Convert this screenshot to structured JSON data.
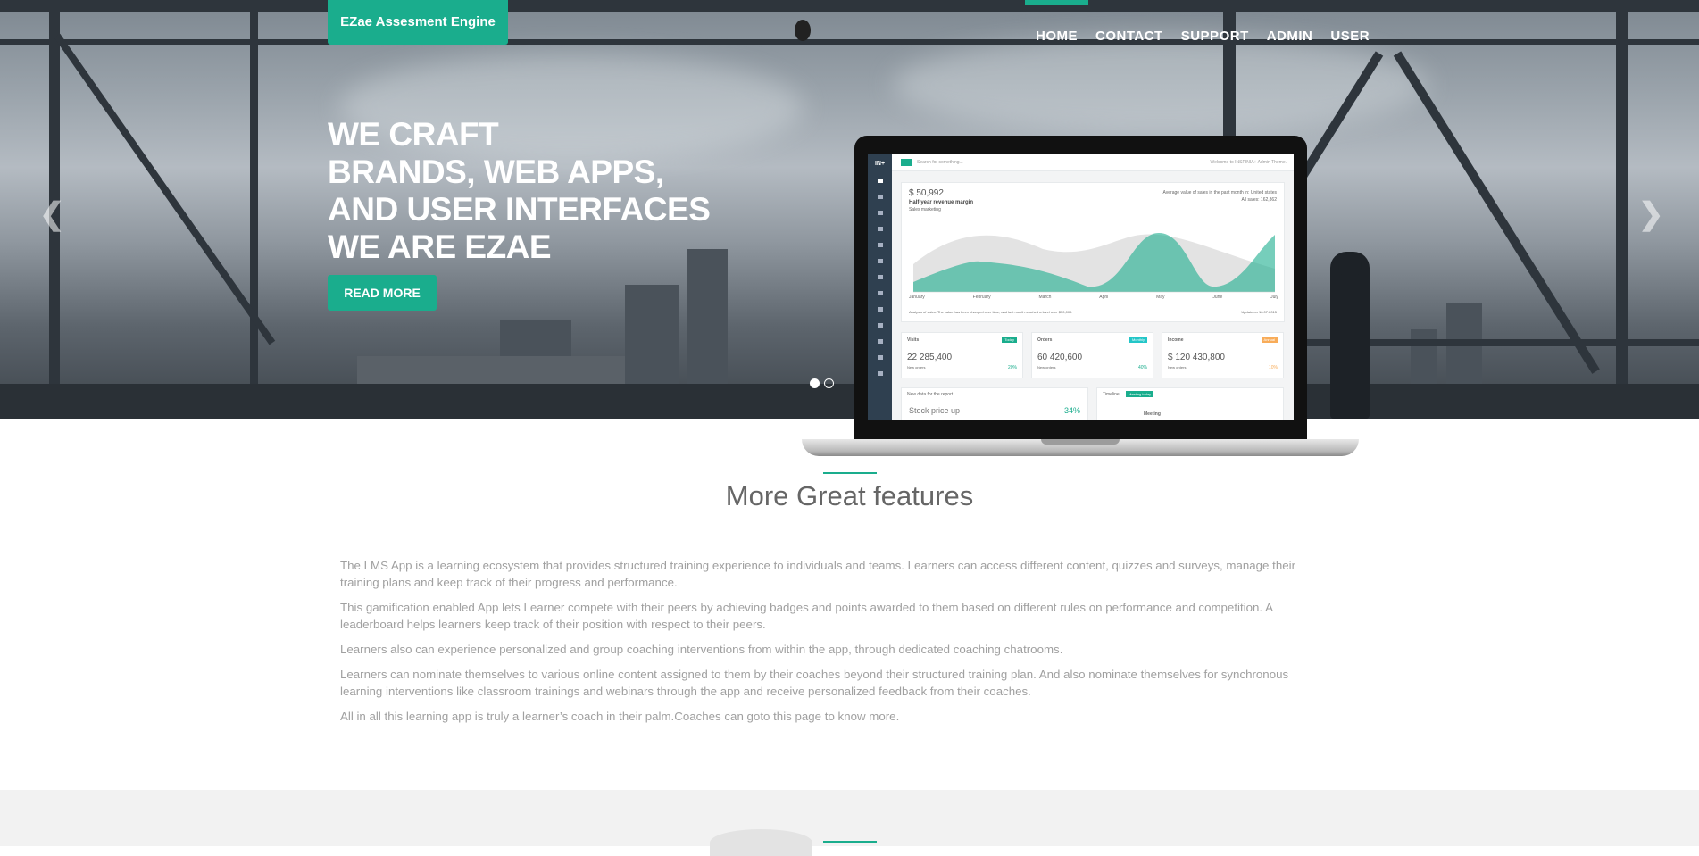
{
  "brand": "EZae Assesment Engine",
  "nav": [
    {
      "label": "HOME",
      "active": true
    },
    {
      "label": "CONTACT",
      "active": false
    },
    {
      "label": "SUPPORT",
      "active": false
    },
    {
      "label": "ADMIN",
      "active": false
    },
    {
      "label": "USER",
      "active": false
    }
  ],
  "hero": {
    "lines": [
      "WE CRAFT",
      "BRANDS, WEB APPS,",
      "AND USER INTERFACES",
      "WE ARE EZAE"
    ],
    "button": "READ MORE",
    "prev_icon": "chevron-left-icon",
    "next_icon": "chevron-right-icon",
    "slides": 2,
    "active_slide": 1
  },
  "dashboard": {
    "logo": "IN+",
    "search": "Search for something...",
    "welcome": "Welcome to INSPINIA+ Admin Theme.",
    "revenue": "$ 50,992",
    "chart_title": "Half-year revenue margin",
    "chart_sub": "Sales marketing",
    "avg_note": "Average value of sales in the past month in: United states",
    "all_sales": "All sales: 162,862",
    "months": [
      "January",
      "February",
      "March",
      "April",
      "May",
      "June",
      "July"
    ],
    "analysis": "Analysis of sales: The value has been changed over time, and last month reached a level over $50,000.",
    "update": "Update on 16.07.2015",
    "cards": [
      {
        "title": "Visits",
        "badge": "Today",
        "value": "22 285,400",
        "sub": "New orders",
        "pct": "20%"
      },
      {
        "title": "Orders",
        "badge": "Monthly",
        "value": "60 420,600",
        "sub": "New orders",
        "pct": "40%"
      },
      {
        "title": "Income",
        "badge": "Annual",
        "value": "$ 120 430,800",
        "sub": "New orders",
        "pct": "10%"
      }
    ],
    "panel_report": "New data for the report",
    "stock": "Stock price up",
    "stock_pct": "34%",
    "timeline": "Timeline",
    "timeline_badge": "Meeting today",
    "meeting": "Meeting"
  },
  "features": {
    "title": "More Great features",
    "paragraphs": [
      "The LMS App is a learning ecosystem that provides structured training experience to individuals and teams. Learners can access different content, quizzes and surveys, manage their training plans and keep track of their progress and performance.",
      "This gamification enabled App lets Learner compete with their peers by achieving badges and points awarded to them based on different rules on performance and competition. A leaderboard helps learners keep track of their position with respect to their peers.",
      "Learners also can experience personalized and group coaching interventions from within the app, through dedicated coaching chatrooms.",
      "Learners can nominate themselves to various online content assigned to them by their coaches beyond their structured training plan. And also nominate themselves for synchronous learning interventions like classroom trainings and webinars through the app and receive personalized feedback from their coaches.",
      "All in all this learning app is truly a learner’s coach in their palm.Coaches can goto this page to know more."
    ]
  }
}
